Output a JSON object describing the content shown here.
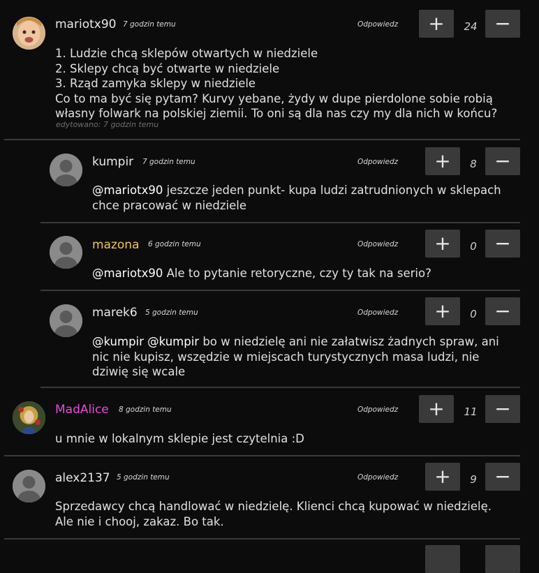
{
  "reply_label": "Odpowiedz",
  "upvote_symbol": "+",
  "downvote_symbol": "−",
  "comments": [
    {
      "user": "mariotx90",
      "time": "7 godzin temu",
      "score": "24",
      "lines": "1. Ludzie chcą sklepów otwartych w niedziele\n2. Sklepy chcą być otwarte w niedziele\n3. Rząd zamyka sklepy w niedziele\nCo to ma być się pytam? Kurvy yebane, żydy w dupe pierdolone sobie robią\nwłasny folwark na polskiej ziemii. To oni są dla nas czy my dla nich w końcu?",
      "edited": "edytowano: 7 godzin temu"
    },
    {
      "user": "kumpir",
      "time": "7 godzin temu",
      "score": "8",
      "mention": "@mariotx90",
      "text": " jeszcze jeden punkt- kupa ludzi zatrudnionych w sklepach\nchce pracować w niedziele"
    },
    {
      "user": "mazona",
      "time": "6 godzin temu",
      "score": "0",
      "mention": "@mariotx90",
      "text": " Ale to pytanie retoryczne, czy ty tak na serio?"
    },
    {
      "user": "marek6",
      "time": "5 godzin temu",
      "score": "0",
      "mention": "@kumpir @kumpir",
      "text": " bo w niedzielę ani nie załatwisz żadnych spraw, ani\nnic nie kupisz, wszędzie w miejscach turystycznych masa ludzi, nie\ndziwię się wcale"
    },
    {
      "user": "MadAlice",
      "time": "8 godzin temu",
      "score": "11",
      "text": "u mnie w lokalnym sklepie jest czytelnia :D"
    },
    {
      "user": "alex2137",
      "time": "5 godzin temu",
      "score": "9",
      "text": "Sprzedawcy chcą handlować w niedzielę. Klienci chcą kupować w niedzielę.\nAle nie i chooj, zakaz. Bo tak."
    }
  ]
}
